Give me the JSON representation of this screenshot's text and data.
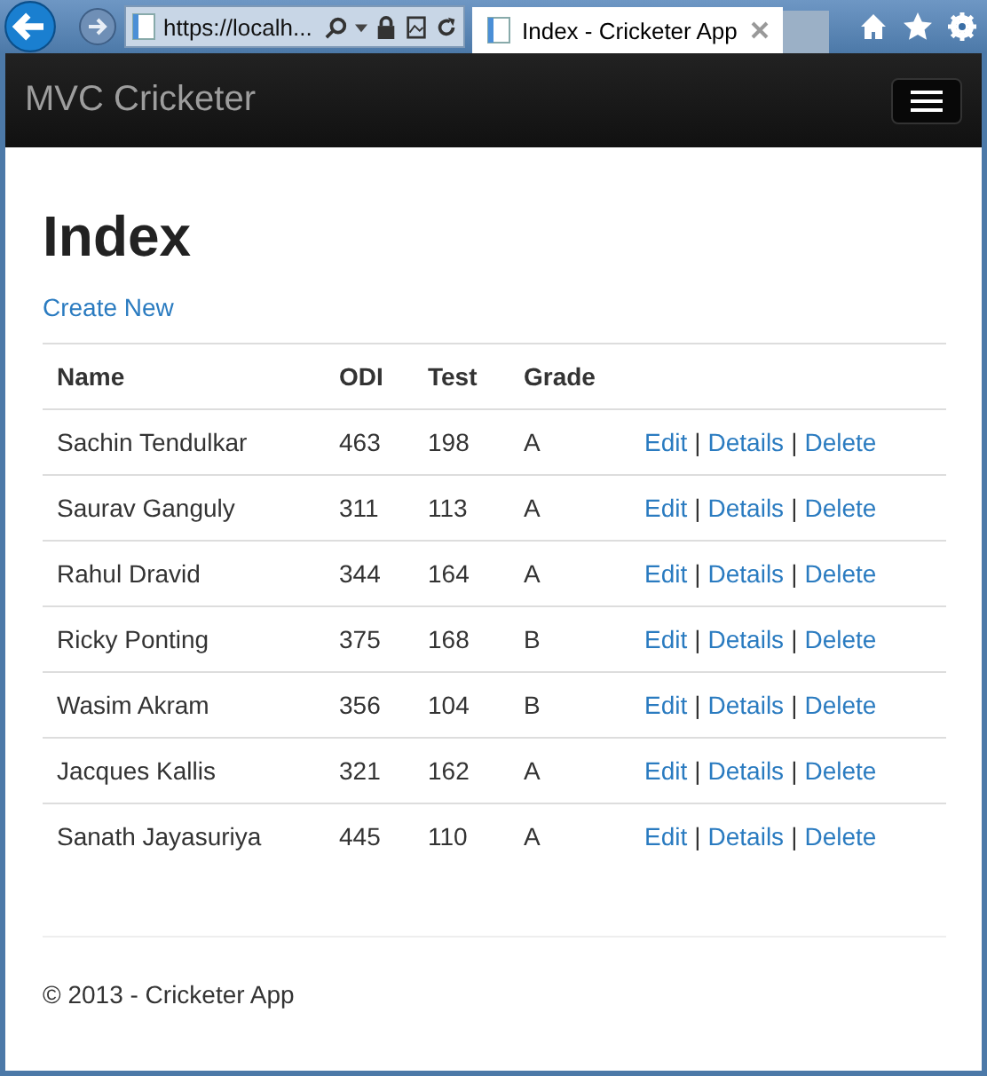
{
  "browser": {
    "address": "https://localh...",
    "tabs": [
      {
        "title": "Index - Cricketer App",
        "selected": true
      }
    ]
  },
  "navbar": {
    "brand": "MVC Cricketer"
  },
  "page": {
    "heading": "Index",
    "create_link": "Create New",
    "table": {
      "columns": [
        "Name",
        "ODI",
        "Test",
        "Grade"
      ],
      "action_separator": "|",
      "rows": [
        {
          "cells": [
            "Sachin Tendulkar",
            "463",
            "198",
            "A"
          ],
          "actions": [
            "Edit",
            "Details",
            "Delete"
          ]
        },
        {
          "cells": [
            "Saurav Ganguly",
            "311",
            "113",
            "A"
          ],
          "actions": [
            "Edit",
            "Details",
            "Delete"
          ]
        },
        {
          "cells": [
            "Rahul Dravid",
            "344",
            "164",
            "A"
          ],
          "actions": [
            "Edit",
            "Details",
            "Delete"
          ]
        },
        {
          "cells": [
            "Ricky Ponting",
            "375",
            "168",
            "B"
          ],
          "actions": [
            "Edit",
            "Details",
            "Delete"
          ]
        },
        {
          "cells": [
            "Wasim Akram",
            "356",
            "104",
            "B"
          ],
          "actions": [
            "Edit",
            "Details",
            "Delete"
          ]
        },
        {
          "cells": [
            "Jacques Kallis",
            "321",
            "162",
            "A"
          ],
          "actions": [
            "Edit",
            "Details",
            "Delete"
          ]
        },
        {
          "cells": [
            "Sanath Jayasuriya",
            "445",
            "110",
            "A"
          ],
          "actions": [
            "Edit",
            "Details",
            "Delete"
          ]
        }
      ]
    }
  },
  "footer": "© 2013 - Cricketer App"
}
